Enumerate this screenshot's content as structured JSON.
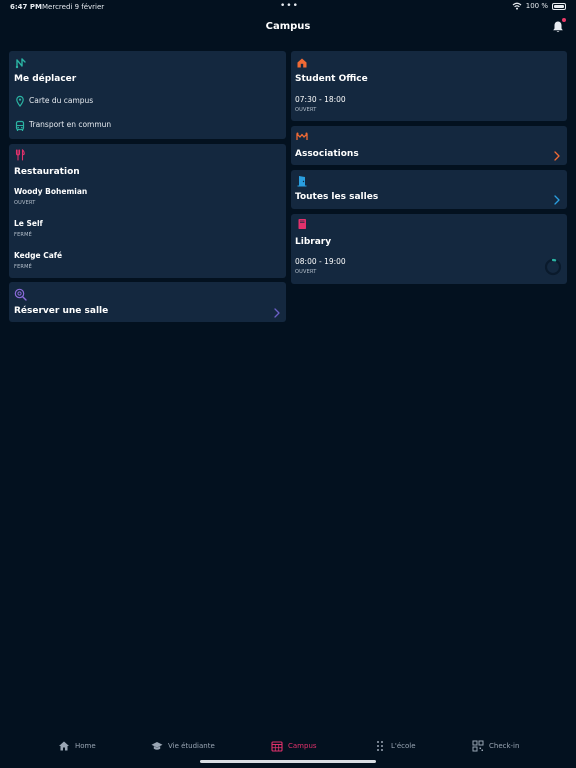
{
  "status_bar": {
    "time": "6:47 PM",
    "date": "Mercredi 9 février",
    "battery": "100 %"
  },
  "header": {
    "title": "Campus"
  },
  "colors": {
    "background": "#03111f",
    "card": "#14283f",
    "accent": "#e2316c",
    "teal": "#2bb3a3",
    "orange": "#f06a35",
    "blue": "#2a9fe0"
  },
  "cards": {
    "move": {
      "title": "Me déplacer",
      "icon": "route-icon",
      "rows": [
        {
          "label": "Carte du campus",
          "icon": "map-pin-icon"
        },
        {
          "label": "Transport en commun",
          "icon": "bus-icon"
        }
      ]
    },
    "food": {
      "title": "Restauration",
      "icon": "fork-knife-icon",
      "items": [
        {
          "name": "Woody Bohemian",
          "status": "OUVERT"
        },
        {
          "name": "Le Self",
          "status": "FERMÉ"
        },
        {
          "name": "Kedge Café",
          "status": "FERMÉ"
        }
      ]
    },
    "book_room": {
      "title": "Réserver une salle",
      "icon": "search-icon"
    },
    "student_office": {
      "title": "Student Office",
      "icon": "home-icon",
      "hours": "07:30 - 18:00",
      "status": "OUVERT"
    },
    "associations": {
      "title": "Associations",
      "icon": "people-icon"
    },
    "rooms": {
      "title": "Toutes les salles",
      "icon": "door-icon"
    },
    "library": {
      "title": "Library",
      "icon": "book-icon",
      "hours": "08:00 - 19:00",
      "status": "OUVERT",
      "progress": 0.05
    }
  },
  "tabbar": {
    "items": [
      {
        "label": "Home",
        "icon": "home-icon"
      },
      {
        "label": "Vie étudiante",
        "icon": "graduation-cap-icon"
      },
      {
        "label": "Campus",
        "icon": "calendar-grid-icon",
        "active": true
      },
      {
        "label": "L'école",
        "icon": "dots-grid-icon"
      },
      {
        "label": "Check-in",
        "icon": "qr-code-icon"
      }
    ]
  }
}
